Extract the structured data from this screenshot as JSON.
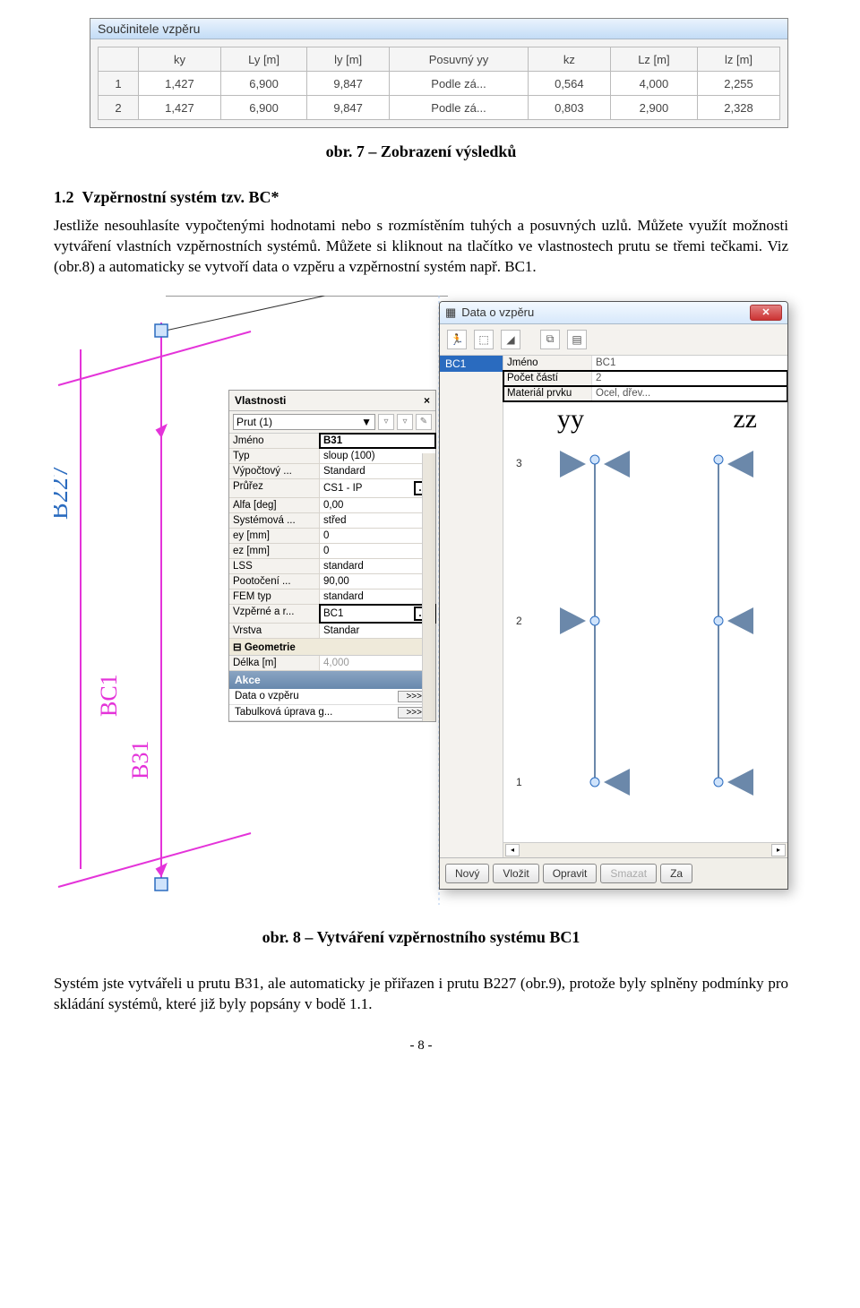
{
  "window1": {
    "title": "Součinitele vzpěru",
    "headers": [
      "",
      "ky",
      "Ly [m]",
      "ly [m]",
      "Posuvný yy",
      "kz",
      "Lz [m]",
      "lz [m]"
    ],
    "rows": [
      [
        "1",
        "1,427",
        "6,900",
        "9,847",
        "Podle zá...",
        "0,564",
        "4,000",
        "2,255"
      ],
      [
        "2",
        "1,427",
        "6,900",
        "9,847",
        "Podle zá...",
        "0,803",
        "2,900",
        "2,328"
      ]
    ]
  },
  "caption7": "obr. 7 – Zobrazení výsledků",
  "section": {
    "num": "1.2",
    "title": "Vzpěrnostní systém tzv. BC*"
  },
  "para_words": [
    "Jestliže",
    "nesouhlasíte",
    "vypočtenými",
    "hodnotami",
    "nebo",
    "s rozmístěním",
    "tuhých",
    "a",
    "posuvných",
    "uzlů.",
    "Můžete",
    "využít",
    "možnosti",
    "vytváření",
    "vlastních",
    "vzpěrnostních",
    "systémů.",
    "Můžete",
    "si",
    "kliknout",
    "na",
    "tlačítko",
    "ve",
    "vlastnostech",
    "prutu",
    "se",
    "třemi",
    "tečkami.",
    "Viz",
    "(obr.8)",
    "a",
    "automaticky",
    "se",
    "vytvoří",
    "data",
    "o",
    "vzpěru",
    "a",
    "vzpěrnostní",
    "systém",
    "např.",
    "BC1."
  ],
  "cad_labels": {
    "b227": "B227",
    "bc1": "BC1",
    "b31": "B31"
  },
  "vlast": {
    "title": "Vlastnosti",
    "combo": "Prut (1)",
    "rows": [
      {
        "k": "Jméno",
        "v": "B31",
        "hi": true,
        "drop": false
      },
      {
        "k": "Typ",
        "v": "sloup (100)",
        "drop": true
      },
      {
        "k": "Výpočtový ...",
        "v": "Standard",
        "drop": true
      },
      {
        "k": "Průřez",
        "v": "CS1 - IP",
        "drop": true,
        "more": "..."
      },
      {
        "k": "Alfa [deg]",
        "v": "0,00"
      },
      {
        "k": "Systémová ...",
        "v": "střed",
        "drop": true
      },
      {
        "k": "ey [mm]",
        "v": "0"
      },
      {
        "k": "ez [mm]",
        "v": "0"
      },
      {
        "k": "LSS",
        "v": "standard",
        "drop": true
      },
      {
        "k": "Pootočení ...",
        "v": "90,00"
      },
      {
        "k": "FEM typ",
        "v": "standard",
        "drop": true
      },
      {
        "k": "Vzpěrné a r...",
        "v": "BC1",
        "drop": true,
        "more": "...",
        "hi2": true
      },
      {
        "k": "Vrstva",
        "v": "Standar",
        "drop": true
      }
    ],
    "group": "Geometrie",
    "group_rows": [
      {
        "k": "Délka [m]",
        "v": "4,000"
      }
    ],
    "akce_label": "Akce",
    "akce": [
      {
        "label": "Data o vzpěru",
        "btn": ">>>"
      },
      {
        "label": "Tabulková úprava g...",
        "btn": ">>>"
      }
    ]
  },
  "dlg": {
    "title": "Data o vzpěru",
    "list_sel": "BC1",
    "props": [
      {
        "k": "Jméno",
        "v": "BC1",
        "boxed": false
      },
      {
        "k": "Počet částí",
        "v": "2",
        "boxed": true
      },
      {
        "k": "Materiál prvku",
        "v": "Ocel, dřev...",
        "boxed": true
      }
    ],
    "yy": "yy",
    "zz": "zz",
    "axis_nums": [
      "3",
      "2",
      "1"
    ],
    "buttons": [
      {
        "label": "Nový",
        "dis": false
      },
      {
        "label": "Vložit",
        "dis": false
      },
      {
        "label": "Opravit",
        "dis": false
      },
      {
        "label": "Smazat",
        "dis": true
      },
      {
        "label": "Za",
        "dis": false
      }
    ]
  },
  "caption8": "obr. 8 – Vytváření vzpěrnostního systému BC1",
  "para2_words": [
    "Systém",
    "jste",
    "vytvářeli",
    "u",
    "prutu",
    "B31,",
    "ale",
    "automaticky",
    "je",
    "přiřazen",
    "i",
    "prutu",
    "B227",
    "(obr.9),",
    "protože",
    "byly",
    "splněny",
    "podmínky",
    "pro",
    "skládání",
    "systémů,",
    "které",
    "již",
    "byly",
    "popsány",
    "v",
    "bodě",
    "1.1."
  ],
  "pagenum": "- 8 -"
}
